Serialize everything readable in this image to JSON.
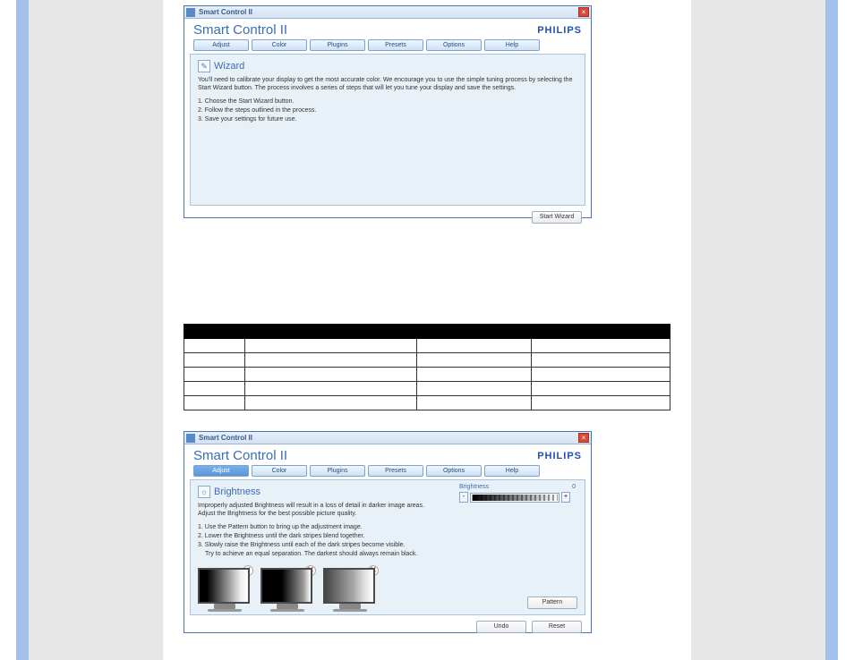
{
  "app": {
    "window_title": "Smart Control II",
    "app_title": "Smart Control II",
    "brand": "PHILIPS",
    "close_glyph": "×"
  },
  "tabs": {
    "adjust": "Adjust",
    "color": "Color",
    "plugins": "Plugins",
    "presets": "Presets",
    "options": "Options",
    "help": "Help"
  },
  "wizard": {
    "title": "Wizard",
    "intro": "You'll need to calibrate your display to get the most accurate color. We encourage you to use the simple tuning process by selecting the Start Wizard button. The process involves a series of steps that will let you tune your display and save the settings.",
    "step1": "1. Choose the Start Wizard button.",
    "step2": "2. Follow the steps outlined in the process.",
    "step3": "3. Save your settings for future use.",
    "start_btn": "Start Wizard"
  },
  "brightness": {
    "title": "Brightness",
    "intro": "Improperly adjusted Brightness will result in a loss of detail in darker image areas. Adjust the Brightness for the best possible picture quality.",
    "step1": "1. Use the Pattern button to bring up the adjustment image.",
    "step2": "2. Lower the Brightness until the dark stripes blend together.",
    "step3": "3. Slowly raise the Brightness until each of the dark stripes become visible.",
    "step3b": "Try to achieve an equal separation. The darkest should always remain black.",
    "slider_label": "Brightness",
    "slider_value": "0",
    "minus": "-",
    "plus": "+",
    "pattern_btn": "Pattern",
    "undo_btn": "Undo",
    "reset_btn": "Reset",
    "mark_ok": "✓",
    "mark_no": "✕"
  }
}
